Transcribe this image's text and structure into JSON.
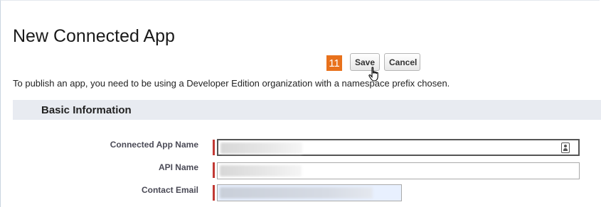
{
  "page": {
    "title": "New Connected App"
  },
  "step_badge": "11",
  "toolbar": {
    "save_label": "Save",
    "cancel_label": "Cancel"
  },
  "notice": "To publish an app, you need to be using a Developer Edition organization with a namespace prefix chosen.",
  "section": {
    "title": "Basic Information"
  },
  "fields": [
    {
      "label": "Connected App Name",
      "required": true
    },
    {
      "label": "API Name",
      "required": true
    },
    {
      "label": "Contact Email",
      "required": true
    }
  ],
  "colors": {
    "required": "#c23934",
    "badge": "#e8711c",
    "section_bg": "#e8ebf1",
    "email_field_bg": "#e8f0fe"
  },
  "icons": {
    "cursor": "hand-pointer-icon",
    "contact_card": "contact-card-icon"
  }
}
